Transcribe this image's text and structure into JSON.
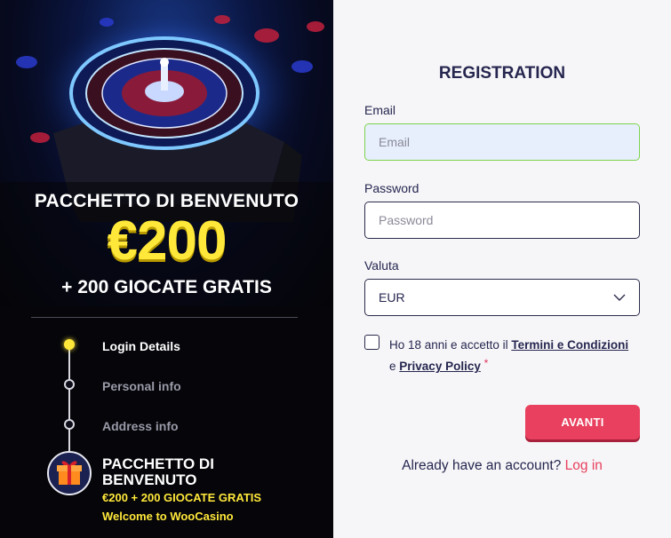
{
  "promo": {
    "headline": "PACCHETTO DI BENVENUTO",
    "amount": "€200",
    "spins": "+ 200 GIOCATE GRATIS"
  },
  "steps": [
    {
      "label": "Login Details",
      "active": true
    },
    {
      "label": "Personal info",
      "active": false
    },
    {
      "label": "Address info",
      "active": false
    }
  ],
  "bonus_card": {
    "title": "PACCHETTO DI BENVENUTO",
    "line1": "€200 + 200 GIOCATE GRATIS",
    "line2": "Welcome to WooCasino"
  },
  "form": {
    "title": "REGISTRATION",
    "email_label": "Email",
    "email_placeholder": "Email",
    "password_label": "Password",
    "password_placeholder": "Password",
    "currency_label": "Valuta",
    "currency_value": "EUR",
    "terms_prefix": "Ho 18 anni e accetto il",
    "terms_link": "Termini e Condizioni",
    "terms_and": "e",
    "privacy_link": "Privacy Policy",
    "required_mark": "*",
    "submit_label": "AVANTI",
    "already_text": "Already have an account?",
    "login_link": "Log in"
  },
  "colors": {
    "accent": "#e8405e",
    "promo_yellow": "#ffe83a",
    "navy": "#262650"
  }
}
